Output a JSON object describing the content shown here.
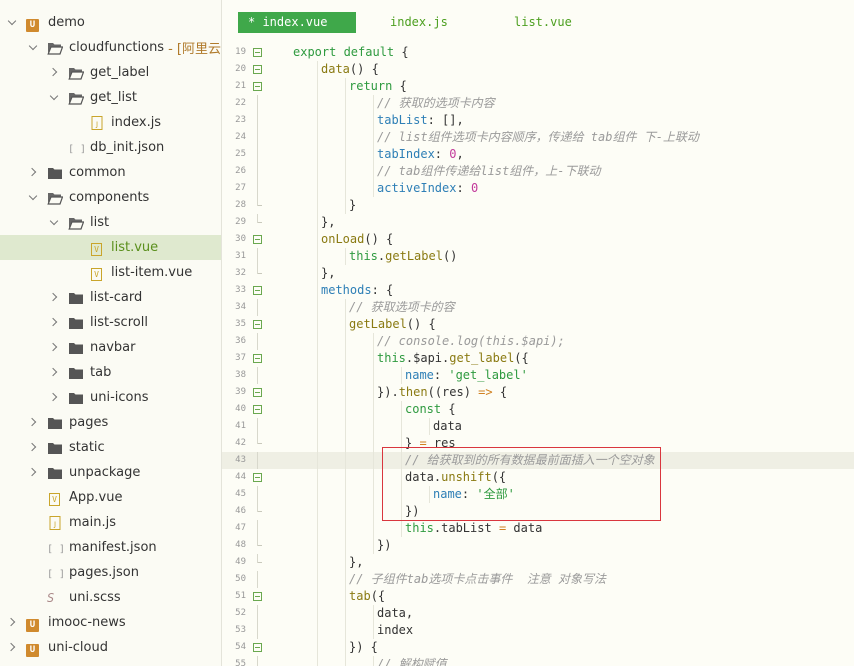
{
  "sidebar": {
    "items": [
      {
        "label": "demo",
        "indent": 0,
        "chevron": "down",
        "icon": "project-icon",
        "icon_glyph": "U"
      },
      {
        "label": "cloudfunctions",
        "suffix": "- [阿里云:zk",
        "indent": 1,
        "chevron": "down",
        "icon": "folder-open-icon"
      },
      {
        "label": "get_label",
        "indent": 2,
        "chevron": "right",
        "icon": "folder-open-icon"
      },
      {
        "label": "get_list",
        "indent": 2,
        "chevron": "down",
        "icon": "folder-open-icon"
      },
      {
        "label": "index.js",
        "indent": 3,
        "chevron": "none",
        "icon": "js-file-icon"
      },
      {
        "label": "db_init.json",
        "indent": 2,
        "chevron": "none",
        "icon": "json-file-icon",
        "icon_glyph": "[ ]"
      },
      {
        "label": "common",
        "indent": 1,
        "chevron": "right",
        "icon": "folder-icon"
      },
      {
        "label": "components",
        "indent": 1,
        "chevron": "down",
        "icon": "folder-open-icon"
      },
      {
        "label": "list",
        "indent": 2,
        "chevron": "down",
        "icon": "folder-open-icon"
      },
      {
        "label": "list.vue",
        "indent": 3,
        "chevron": "none",
        "icon": "vue-file-icon",
        "icon_glyph": "V",
        "selected": true
      },
      {
        "label": "list-item.vue",
        "indent": 3,
        "chevron": "none",
        "icon": "vue-file-icon",
        "icon_glyph": "V"
      },
      {
        "label": "list-card",
        "indent": 2,
        "chevron": "right",
        "icon": "folder-icon"
      },
      {
        "label": "list-scroll",
        "indent": 2,
        "chevron": "right",
        "icon": "folder-icon"
      },
      {
        "label": "navbar",
        "indent": 2,
        "chevron": "right",
        "icon": "folder-icon"
      },
      {
        "label": "tab",
        "indent": 2,
        "chevron": "right",
        "icon": "folder-icon"
      },
      {
        "label": "uni-icons",
        "indent": 2,
        "chevron": "right",
        "icon": "folder-icon"
      },
      {
        "label": "pages",
        "indent": 1,
        "chevron": "right",
        "icon": "folder-icon"
      },
      {
        "label": "static",
        "indent": 1,
        "chevron": "right",
        "icon": "folder-icon"
      },
      {
        "label": "unpackage",
        "indent": 1,
        "chevron": "right",
        "icon": "folder-icon"
      },
      {
        "label": "App.vue",
        "indent": 1,
        "chevron": "none",
        "icon": "vue-file-icon",
        "icon_glyph": "V"
      },
      {
        "label": "main.js",
        "indent": 1,
        "chevron": "none",
        "icon": "js-file-icon"
      },
      {
        "label": "manifest.json",
        "indent": 1,
        "chevron": "none",
        "icon": "json-file-icon",
        "icon_glyph": "[ ]"
      },
      {
        "label": "pages.json",
        "indent": 1,
        "chevron": "none",
        "icon": "json-file-icon",
        "icon_glyph": "[ ]"
      },
      {
        "label": "uni.scss",
        "indent": 1,
        "chevron": "none",
        "icon": "scss-file-icon",
        "icon_glyph": "S"
      },
      {
        "label": "imooc-news",
        "indent": 0,
        "chevron": "right",
        "icon": "project-icon",
        "icon_glyph": "U"
      },
      {
        "label": "uni-cloud",
        "indent": 0,
        "chevron": "right",
        "icon": "project-icon",
        "icon_glyph": "U"
      }
    ]
  },
  "tabs": [
    {
      "label": "* index.vue",
      "active": true
    },
    {
      "label": "index.js",
      "active": false
    },
    {
      "label": "list.vue",
      "active": false
    }
  ],
  "code": {
    "lines": [
      {
        "n": "19",
        "fold": "open",
        "indent": 1,
        "tokens": [
          [
            "kw",
            "export "
          ],
          [
            "kw",
            "default "
          ],
          [
            "tx",
            "{"
          ]
        ]
      },
      {
        "n": "20",
        "fold": "open",
        "indent": 2,
        "tokens": [
          [
            "fn",
            "data"
          ],
          [
            "tx",
            "() {"
          ]
        ]
      },
      {
        "n": "21",
        "fold": "open",
        "indent": 3,
        "tokens": [
          [
            "kw",
            "return "
          ],
          [
            "tx",
            "{"
          ]
        ]
      },
      {
        "n": "22",
        "fold": "line",
        "indent": 4,
        "tokens": [
          [
            "cm",
            "// 获取的选项卡内容"
          ]
        ]
      },
      {
        "n": "23",
        "fold": "line",
        "indent": 4,
        "tokens": [
          [
            "pr",
            "tabList"
          ],
          [
            "tx",
            ": [],"
          ]
        ]
      },
      {
        "n": "24",
        "fold": "line",
        "indent": 4,
        "tokens": [
          [
            "cm",
            "// list组件选项卡内容顺序，传递给 tab组件 下-上联动"
          ]
        ]
      },
      {
        "n": "25",
        "fold": "line",
        "indent": 4,
        "tokens": [
          [
            "pr",
            "tabIndex"
          ],
          [
            "tx",
            ": "
          ],
          [
            "num",
            "0"
          ],
          [
            "tx",
            ","
          ]
        ]
      },
      {
        "n": "26",
        "fold": "line",
        "indent": 4,
        "tokens": [
          [
            "cm",
            "// tab组件传递给list组件，上-下联动"
          ]
        ]
      },
      {
        "n": "27",
        "fold": "line",
        "indent": 4,
        "tokens": [
          [
            "pr",
            "activeIndex"
          ],
          [
            "tx",
            ": "
          ],
          [
            "num",
            "0"
          ]
        ]
      },
      {
        "n": "28",
        "fold": "end",
        "indent": 3,
        "tokens": [
          [
            "tx",
            "}"
          ]
        ]
      },
      {
        "n": "29",
        "fold": "end",
        "indent": 2,
        "tokens": [
          [
            "tx",
            "},"
          ]
        ]
      },
      {
        "n": "30",
        "fold": "open",
        "indent": 2,
        "tokens": [
          [
            "fn",
            "onLoad"
          ],
          [
            "tx",
            "() {"
          ]
        ]
      },
      {
        "n": "31",
        "fold": "line",
        "indent": 3,
        "tokens": [
          [
            "kw",
            "this"
          ],
          [
            "tx",
            "."
          ],
          [
            "fn",
            "getLabel"
          ],
          [
            "tx",
            "()"
          ]
        ]
      },
      {
        "n": "32",
        "fold": "end",
        "indent": 2,
        "tokens": [
          [
            "tx",
            "},"
          ]
        ]
      },
      {
        "n": "33",
        "fold": "open",
        "indent": 2,
        "tokens": [
          [
            "pr",
            "methods"
          ],
          [
            "tx",
            ": {"
          ]
        ]
      },
      {
        "n": "34",
        "fold": "line",
        "indent": 3,
        "tokens": [
          [
            "cm",
            "// 获取选项卡的容"
          ]
        ]
      },
      {
        "n": "35",
        "fold": "open",
        "indent": 3,
        "tokens": [
          [
            "fn",
            "getLabel"
          ],
          [
            "tx",
            "() {"
          ]
        ]
      },
      {
        "n": "36",
        "fold": "line",
        "indent": 4,
        "tokens": [
          [
            "cm",
            "// console.log(this.$api);"
          ]
        ]
      },
      {
        "n": "37",
        "fold": "open",
        "indent": 4,
        "tokens": [
          [
            "kw",
            "this"
          ],
          [
            "tx",
            ".$api."
          ],
          [
            "fn",
            "get_label"
          ],
          [
            "tx",
            "({"
          ]
        ]
      },
      {
        "n": "38",
        "fold": "line",
        "indent": 5,
        "tokens": [
          [
            "pr",
            "name"
          ],
          [
            "tx",
            ": "
          ],
          [
            "str",
            "'get_label'"
          ]
        ]
      },
      {
        "n": "39",
        "fold": "open",
        "indent": 4,
        "tokens": [
          [
            "tx",
            "})."
          ],
          [
            "fn",
            "then"
          ],
          [
            "tx",
            "((res) "
          ],
          [
            "op",
            "=>"
          ],
          [
            "tx",
            " {"
          ]
        ]
      },
      {
        "n": "40",
        "fold": "open",
        "indent": 5,
        "tokens": [
          [
            "kw",
            "const "
          ],
          [
            "tx",
            "{"
          ]
        ]
      },
      {
        "n": "41",
        "fold": "line",
        "indent": 6,
        "tokens": [
          [
            "tx",
            "data"
          ]
        ]
      },
      {
        "n": "42",
        "fold": "end",
        "indent": 5,
        "tokens": [
          [
            "tx",
            "} "
          ],
          [
            "op",
            "= "
          ],
          [
            "tx",
            "res"
          ]
        ]
      },
      {
        "n": "43",
        "fold": "line",
        "indent": 5,
        "current": true,
        "tokens": [
          [
            "cm",
            "// 给获取到的所有数据最前面插入一个空对象"
          ]
        ]
      },
      {
        "n": "44",
        "fold": "open",
        "indent": 5,
        "tokens": [
          [
            "tx",
            "data."
          ],
          [
            "fn",
            "unshift"
          ],
          [
            "tx",
            "({"
          ]
        ]
      },
      {
        "n": "45",
        "fold": "line",
        "indent": 6,
        "tokens": [
          [
            "pr",
            "name"
          ],
          [
            "tx",
            ": "
          ],
          [
            "str",
            "'全部'"
          ]
        ]
      },
      {
        "n": "46",
        "fold": "end",
        "indent": 5,
        "tokens": [
          [
            "tx",
            "})"
          ]
        ]
      },
      {
        "n": "47",
        "fold": "line",
        "indent": 5,
        "tokens": [
          [
            "kw",
            "this"
          ],
          [
            "tx",
            ".tabList "
          ],
          [
            "op",
            "= "
          ],
          [
            "tx",
            "data"
          ]
        ]
      },
      {
        "n": "48",
        "fold": "end",
        "indent": 4,
        "tokens": [
          [
            "tx",
            "})"
          ]
        ]
      },
      {
        "n": "49",
        "fold": "end",
        "indent": 3,
        "tokens": [
          [
            "tx",
            "},"
          ]
        ]
      },
      {
        "n": "50",
        "fold": "line",
        "indent": 3,
        "tokens": [
          [
            "cm",
            "// 子组件tab选项卡点击事件  注意 对象写法"
          ]
        ]
      },
      {
        "n": "51",
        "fold": "open",
        "indent": 3,
        "tokens": [
          [
            "fn",
            "tab"
          ],
          [
            "tx",
            "({"
          ]
        ]
      },
      {
        "n": "52",
        "fold": "line",
        "indent": 4,
        "tokens": [
          [
            "tx",
            "data,"
          ]
        ]
      },
      {
        "n": "53",
        "fold": "line",
        "indent": 4,
        "tokens": [
          [
            "tx",
            "index"
          ]
        ]
      },
      {
        "n": "54",
        "fold": "open",
        "indent": 3,
        "tokens": [
          [
            "tx",
            "}) {"
          ]
        ]
      },
      {
        "n": "55",
        "fold": "line",
        "indent": 4,
        "tokens": [
          [
            "cm",
            "// 解构赋值"
          ]
        ]
      }
    ]
  },
  "colors": {
    "accent": "#3fa84a",
    "highlight_box": "#d9363e",
    "selected_row": "#dfe9cf"
  }
}
